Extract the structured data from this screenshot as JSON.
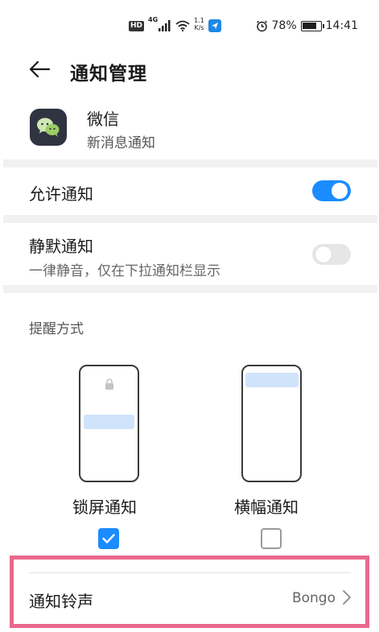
{
  "status_bar": {
    "hd": "HD",
    "network": "4G",
    "speed_value": "1.1",
    "speed_unit": "K/s",
    "battery": "78%",
    "time": "14:41",
    "battery_level": 0.78,
    "icons": [
      "hd-icon",
      "signal-icon",
      "wifi-icon",
      "app-notification-icon",
      "alarm-icon",
      "battery-icon"
    ]
  },
  "header": {
    "title": "通知管理",
    "back_icon": "back-arrow-icon"
  },
  "app": {
    "name": "微信",
    "subtitle": "新消息通知",
    "icon": "wechat-icon"
  },
  "settings": {
    "allow": {
      "label": "允许通知",
      "enabled": true
    },
    "silent": {
      "label": "静默通知",
      "description": "一律静音，仅在下拉通知栏显示",
      "enabled": false
    }
  },
  "reminder": {
    "section_title": "提醒方式",
    "options": [
      {
        "label": "锁屏通知",
        "checked": true
      },
      {
        "label": "横幅通知",
        "checked": false
      }
    ]
  },
  "ringtone": {
    "label": "通知铃声",
    "value": "Bongo"
  },
  "colors": {
    "accent": "#1a8cff",
    "highlight_border": "#e8698c",
    "divider": "#f1f1f1",
    "preview_bar": "#cfe3fb"
  }
}
